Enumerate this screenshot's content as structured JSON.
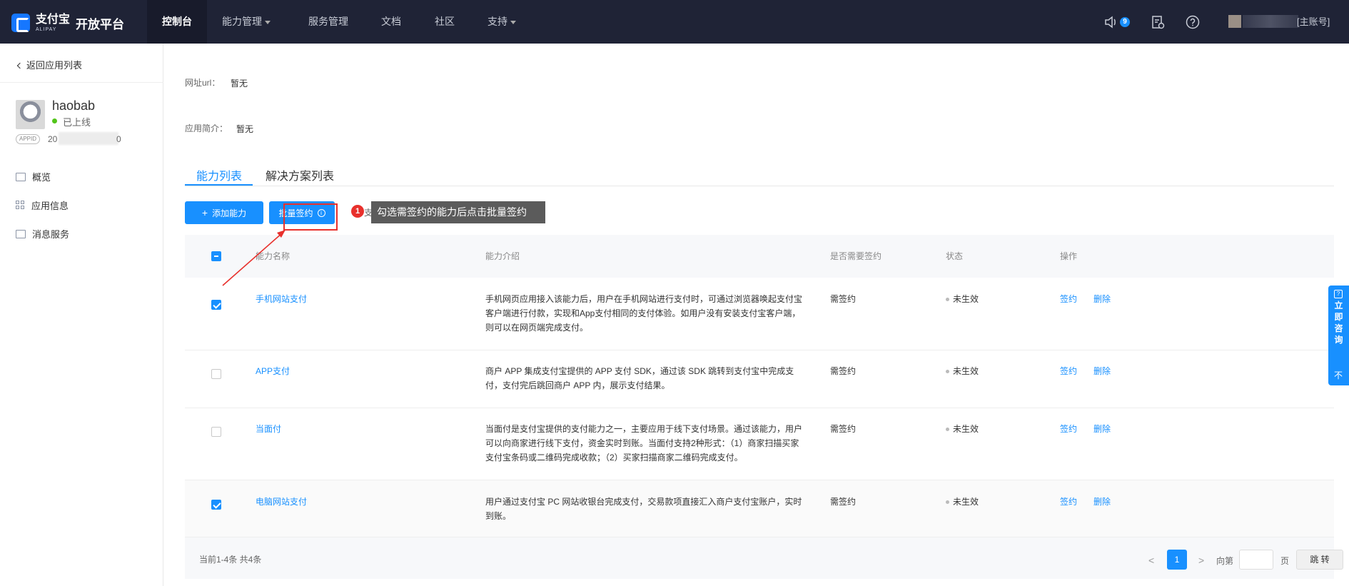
{
  "topnav": {
    "logo_cn": "支付宝",
    "logo_en": "ALIPAY",
    "platform": "开放平台",
    "items": [
      "控制台",
      "能力管理",
      "服务管理",
      "文档",
      "社区",
      "支持"
    ],
    "notification_count": "9",
    "account_label": "[主账号]"
  },
  "sidebar": {
    "back_label": "返回应用列表",
    "app_name": "haobab",
    "app_status": "已上线",
    "appid_tag": "APPID",
    "appid_prefix": "20",
    "appid_suffix": "0",
    "menu": [
      "概览",
      "应用信息",
      "消息服务"
    ]
  },
  "main": {
    "url_label": "网址url：",
    "url_value": "暂无",
    "intro_label": "应用简介：",
    "intro_value": "暂无",
    "tabs": [
      "能力列表",
      "解决方案列表"
    ],
    "add_button": "添加能力",
    "batch_button": "批量签约",
    "hidden_char": "支",
    "annotation_number": "1",
    "tooltip": "勾选需签约的能力后点击批量签约"
  },
  "table": {
    "headers": [
      "能力名称",
      "能力介绍",
      "是否需要签约",
      "状态",
      "操作"
    ],
    "rows": [
      {
        "name": "手机网站支付",
        "desc_lines": [
          "手机网页应用接入该能力后，用户在手机网站进行支付时，可通过浏览器唤起支付宝",
          "客户端进行付款，实现和App支付相同的支付体验。如用户没有安装支付宝客户端，",
          "则可以在网页端完成支付。"
        ],
        "sign": "需签约",
        "status": "未生效",
        "action_sign": "签约",
        "action_delete": "删除",
        "checked": true
      },
      {
        "name": "APP支付",
        "desc_lines": [
          "商户 APP 集成支付宝提供的 APP 支付 SDK，通过该 SDK 跳转到支付宝中完成支",
          "付，支付完后跳回商户 APP 内，展示支付结果。"
        ],
        "sign": "需签约",
        "status": "未生效",
        "action_sign": "签约",
        "action_delete": "删除",
        "checked": false
      },
      {
        "name": "当面付",
        "desc_lines": [
          "当面付是支付宝提供的支付能力之一，主要应用于线下支付场景。通过该能力，用户",
          "可以向商家进行线下支付，资金实时到账。当面付支持2种形式：（1）商家扫描买家",
          "支付宝条码或二维码完成收款；（2）买家扫描商家二维码完成支付。"
        ],
        "sign": "需签约",
        "status": "未生效",
        "action_sign": "签约",
        "action_delete": "删除",
        "checked": false
      },
      {
        "name": "电脑网站支付",
        "desc_lines": [
          "用户通过支付宝 PC 网站收银台完成支付，交易款项直接汇入商户支付宝账户，实时",
          "到账。"
        ],
        "sign": "需签约",
        "status": "未生效",
        "action_sign": "签约",
        "action_delete": "删除",
        "checked": true
      }
    ]
  },
  "pagination": {
    "summary": "当前1-4条 共4条",
    "prev": "<",
    "current_page": "1",
    "next": ">",
    "goto_label": "向第",
    "page_unit": "页",
    "goto_button": "跳 转"
  },
  "consult": {
    "label": "立即咨询",
    "icon_char": "?",
    "bottom_char": "不"
  },
  "colors": {
    "primary": "#1890ff",
    "nav_bg": "#1f2336",
    "annotation_red": "#e8302c",
    "tooltip_bg": "#5b5b5b"
  }
}
